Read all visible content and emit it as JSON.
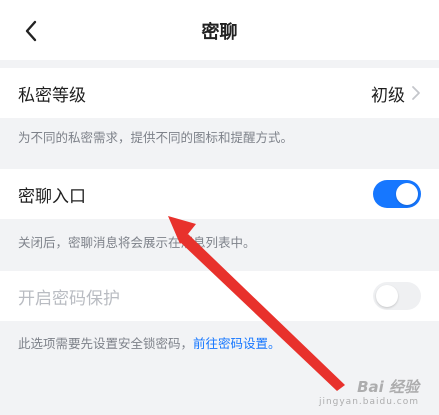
{
  "header": {
    "back_icon": "chevron-left-icon",
    "title": "密聊"
  },
  "privacy_level": {
    "label": "私密等级",
    "value": "初级",
    "arrow_icon": "chevron-right-icon",
    "description": "为不同的私密需求，提供不同的图标和提醒方式。"
  },
  "secret_chat_entry": {
    "label": "密聊入口",
    "enabled": true,
    "description": "关闭后，密聊消息将会展示在消息列表中。"
  },
  "password_protection": {
    "label": "开启密码保护",
    "enabled": false,
    "disabled": true,
    "description": "此选项需要先设置安全锁密码，",
    "link": "前往密码设置。"
  },
  "colors": {
    "accent": "#1677ff",
    "arrow": "#e8312c",
    "background": "#f2f3f5"
  },
  "watermark": {
    "main": "Bai 经验",
    "sub": "jingyan.baidu.com"
  }
}
